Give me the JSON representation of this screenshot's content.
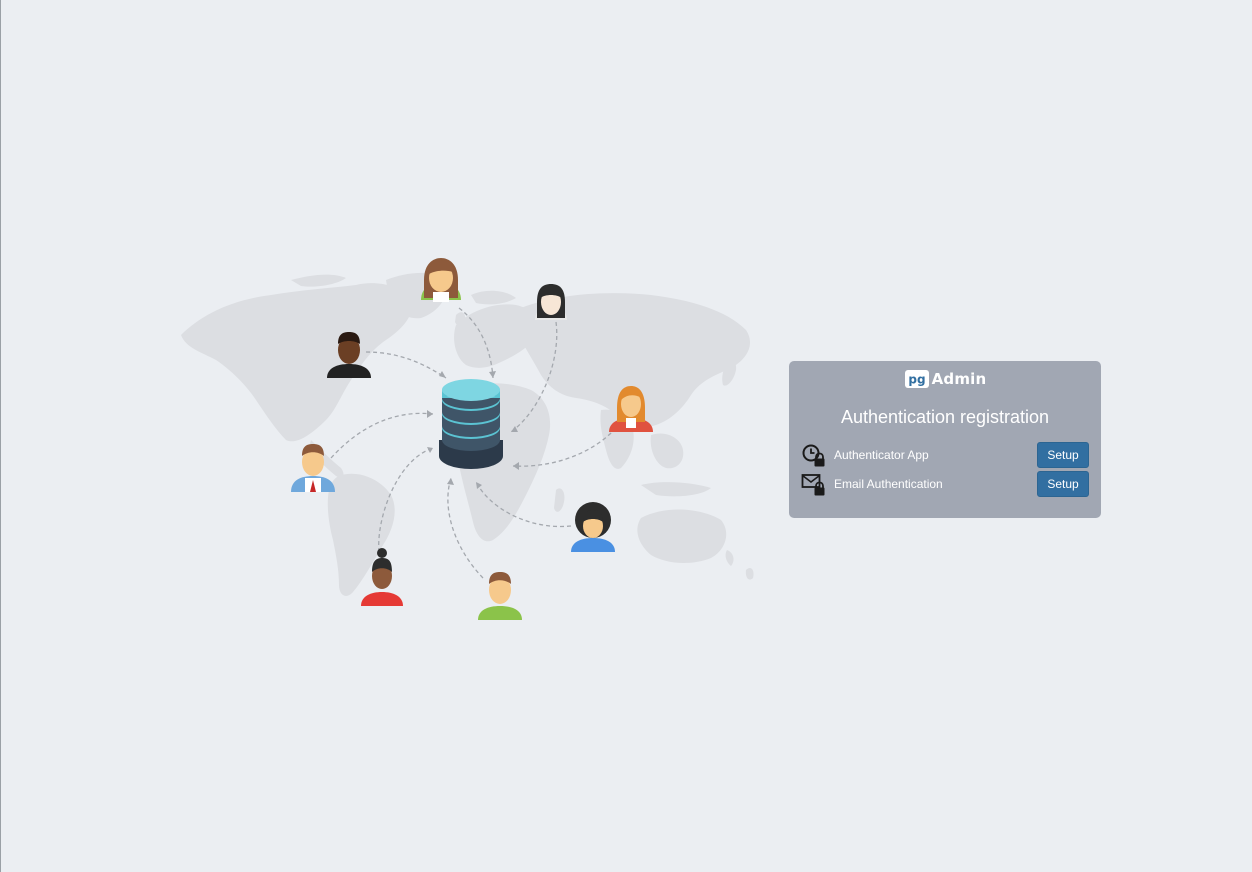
{
  "brand": {
    "logo_mark": "pg",
    "logo_text": "Admin"
  },
  "panel": {
    "title": "Authentication registration",
    "methods": [
      {
        "label": "Authenticator App",
        "icon": "authenticator-app-lock-icon",
        "button_label": "Setup"
      },
      {
        "label": "Email Authentication",
        "icon": "email-lock-icon",
        "button_label": "Setup"
      }
    ]
  },
  "illustration": {
    "description_icon": "world-map-database-users-illustration"
  },
  "colors": {
    "background": "#ebeef2",
    "panel": "#a1a7b3",
    "button": "#326fa1",
    "map": "#dfe1e4"
  }
}
